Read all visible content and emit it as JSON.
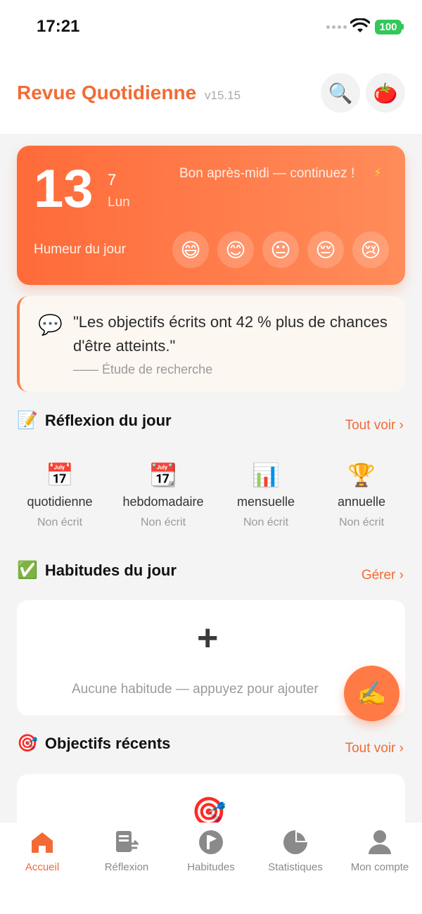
{
  "status_bar": {
    "time": "17:21",
    "battery": "100"
  },
  "header": {
    "title": "Revue Quotidienne",
    "version": "v15.15",
    "search_icon": "🔍",
    "avatar_icon": "🍅"
  },
  "hero": {
    "day": "13",
    "month": "7",
    "weekday": "Lun",
    "greeting": "Bon après-midi — continuez !",
    "bolt": "⚡",
    "mood_label": "Humeur du jour",
    "moods": [
      "😄",
      "😊",
      "😐",
      "😔",
      "😢"
    ]
  },
  "quote": {
    "icon": "💬",
    "text": "\"Les objectifs écrits ont 42 % plus de chances d'être atteints.\"",
    "source": "—— Étude de recherche"
  },
  "reflection": {
    "icon": "📝",
    "title": "Réflexion du jour",
    "link": "Tout voir ›",
    "items": [
      {
        "icon": "📅",
        "label": "quotidienne",
        "status": "Non écrit"
      },
      {
        "icon": "📆",
        "label": "hebdomadaire",
        "status": "Non écrit"
      },
      {
        "icon": "📊",
        "label": "mensuelle",
        "status": "Non écrit"
      },
      {
        "icon": "🏆",
        "label": "annuelle",
        "status": "Non écrit"
      }
    ]
  },
  "habits": {
    "icon": "✅",
    "title": "Habitudes du jour",
    "link": "Gérer ›",
    "plus": "+",
    "empty_text": "Aucune habitude — appuyez pour ajouter"
  },
  "fab": {
    "icon": "✍️"
  },
  "goals": {
    "icon": "🎯",
    "title": "Objectifs récents",
    "link": "Tout voir ›"
  },
  "tabs": [
    {
      "label": "Accueil",
      "icon": "home-icon"
    },
    {
      "label": "Réflexion",
      "icon": "reflection-icon"
    },
    {
      "label": "Habitudes",
      "icon": "habits-icon"
    },
    {
      "label": "Statistiques",
      "icon": "stats-icon"
    },
    {
      "label": "Mon compte",
      "icon": "account-icon"
    }
  ],
  "colors": {
    "accent": "#f26b35",
    "inactive": "#8a8a8a"
  }
}
